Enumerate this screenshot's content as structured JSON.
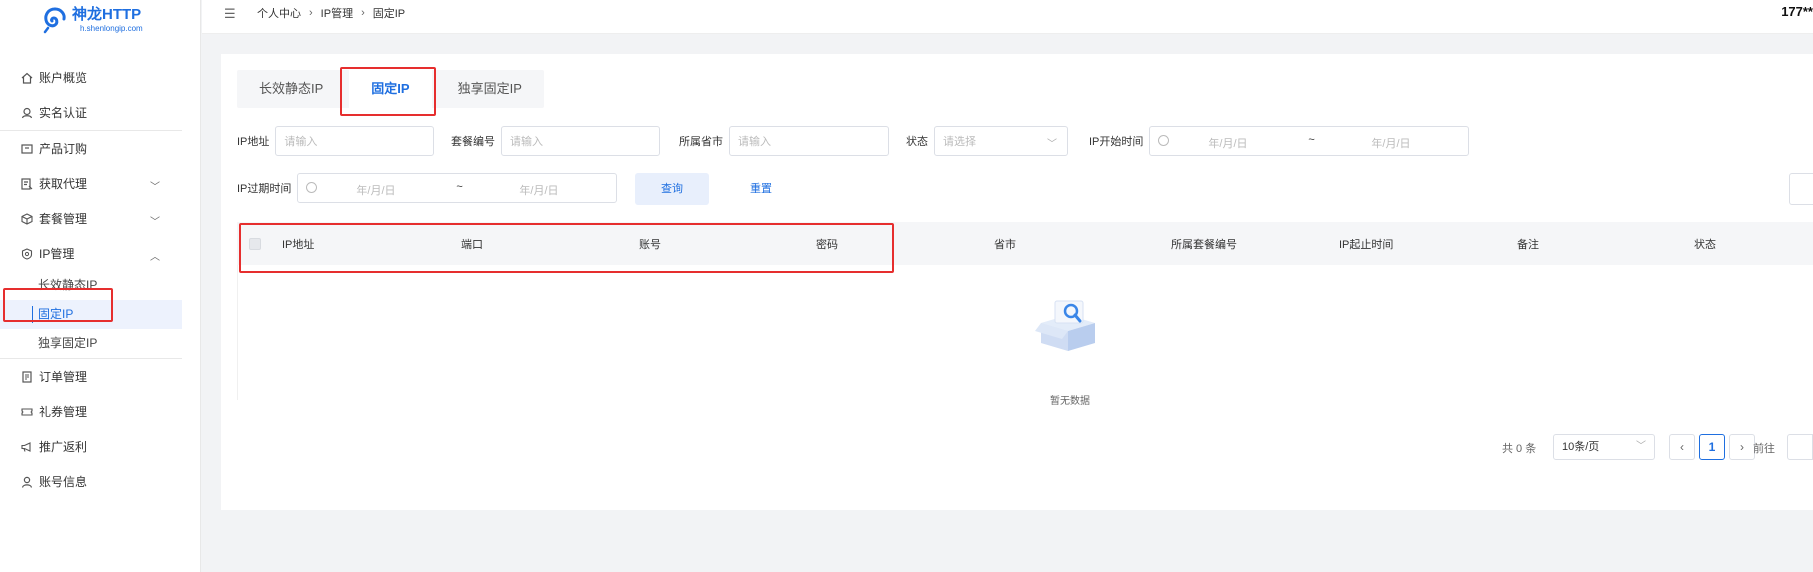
{
  "brand": {
    "title": "神龙HTTP",
    "subtitle": "h.shenlongip.com",
    "color": "#1f6fe0"
  },
  "sidebar": {
    "items": [
      {
        "label": "账户概览",
        "icon": "home-icon"
      },
      {
        "label": "实名认证",
        "icon": "user-verify-icon"
      },
      {
        "label": "产品订购",
        "icon": "cart-icon"
      },
      {
        "label": "获取代理",
        "icon": "proxy-icon"
      },
      {
        "label": "套餐管理",
        "icon": "package-icon"
      },
      {
        "label": "IP管理",
        "icon": "ip-icon"
      },
      {
        "label": "订单管理",
        "icon": "order-icon"
      },
      {
        "label": "礼券管理",
        "icon": "coupon-icon"
      },
      {
        "label": "推广返利",
        "icon": "megaphone-icon"
      },
      {
        "label": "账号信息",
        "icon": "account-icon"
      }
    ],
    "ip_sub": [
      "长效静态IP",
      "固定IP",
      "独享固定IP"
    ]
  },
  "header": {
    "breadcrumb": [
      "个人中心",
      "IP管理",
      "固定IP"
    ],
    "user": "177**"
  },
  "tabs": [
    "长效静态IP",
    "固定IP",
    "独享固定IP"
  ],
  "filters": {
    "ip_label": "IP地址",
    "ip_placeholder": "请输入",
    "package_label": "套餐编号",
    "package_placeholder": "请输入",
    "province_label": "所属省市",
    "province_placeholder": "请输入",
    "status_label": "状态",
    "status_placeholder": "请选择",
    "start_label": "IP开始时间",
    "expire_label": "IP过期时间",
    "date_placeholder": "年/月/日",
    "tilde": "~",
    "query": "查询",
    "reset": "重置"
  },
  "table": {
    "columns": [
      "IP地址",
      "端口",
      "账号",
      "密码",
      "省市",
      "所属套餐编号",
      "IP起止时间",
      "备注",
      "状态"
    ],
    "empty": "暂无数据"
  },
  "pagination": {
    "total": "共 0 条",
    "page_size": "10条/页",
    "prev": "‹",
    "current": "1",
    "next": "›",
    "goto": "前往"
  },
  "colors": {
    "accent": "#1f6fe0",
    "highlight": "#e62e2e",
    "active_bg": "#edf2fd"
  }
}
